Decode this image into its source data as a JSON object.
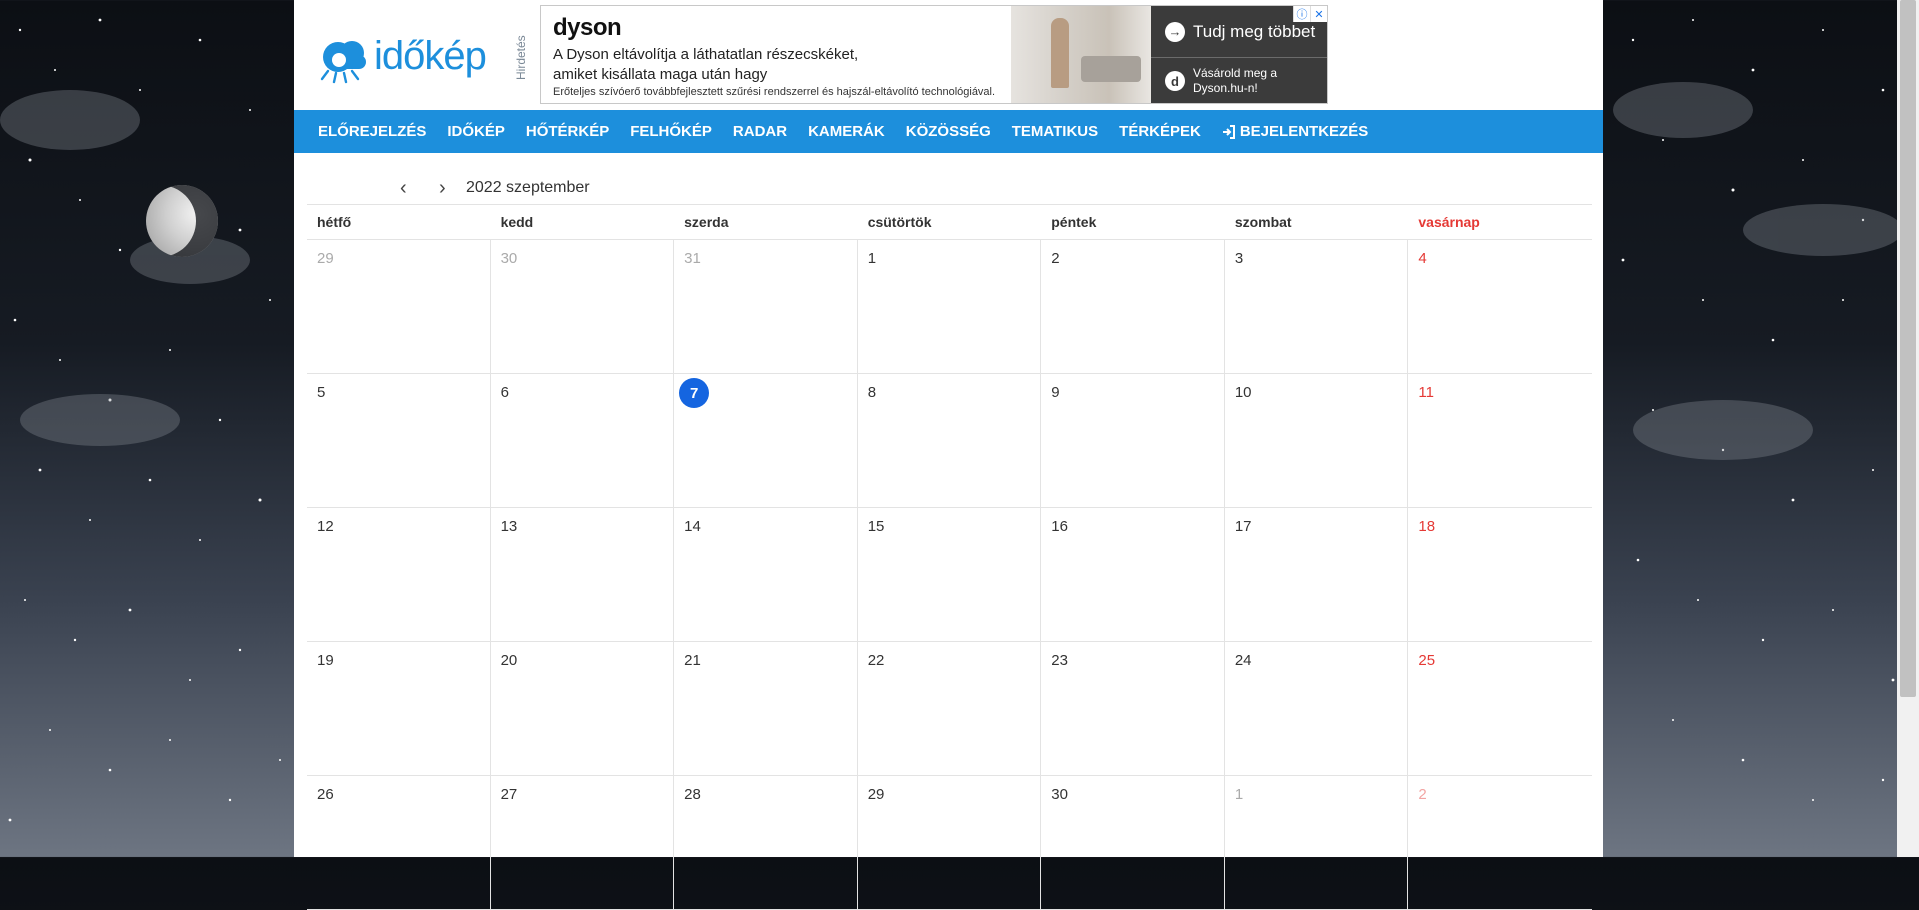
{
  "brand": {
    "logo_text": "időkép"
  },
  "ad": {
    "label": "Hirdetés",
    "brand": "dyson",
    "line1": "A Dyson eltávolítja a láthatatlan részecskéket,",
    "line2": "amiket kisállata maga után hagy",
    "line3": "Erőteljes szívóerő továbbfejlesztett szűrési rendszerrel és hajszál-eltávolító technológiával.",
    "cta_primary": "Tudj meg többet",
    "cta_secondary_line1": "Vásárold meg a",
    "cta_secondary_line2": "Dyson.hu-n!",
    "cta_secondary_icon_letter": "d"
  },
  "nav": {
    "items": [
      {
        "label": "ELŐREJELZÉS"
      },
      {
        "label": "IDŐKÉP"
      },
      {
        "label": "HŐTÉRKÉP"
      },
      {
        "label": "FELHŐKÉP"
      },
      {
        "label": "RADAR"
      },
      {
        "label": "KAMERÁK"
      },
      {
        "label": "KÖZÖSSÉG"
      },
      {
        "label": "TEMATIKUS"
      },
      {
        "label": "TÉRKÉPEK"
      },
      {
        "label": "BEJELENTKEZÉS"
      }
    ]
  },
  "calendar": {
    "title": "2022 szeptember",
    "weekdays": [
      "hétfő",
      "kedd",
      "szerda",
      "csütörtök",
      "péntek",
      "szombat",
      "vasárnap"
    ],
    "weeks": [
      [
        {
          "d": "29",
          "other": true
        },
        {
          "d": "30",
          "other": true
        },
        {
          "d": "31",
          "other": true
        },
        {
          "d": "1"
        },
        {
          "d": "2"
        },
        {
          "d": "3"
        },
        {
          "d": "4"
        }
      ],
      [
        {
          "d": "5"
        },
        {
          "d": "6"
        },
        {
          "d": "7",
          "today": true
        },
        {
          "d": "8"
        },
        {
          "d": "9"
        },
        {
          "d": "10"
        },
        {
          "d": "11"
        }
      ],
      [
        {
          "d": "12"
        },
        {
          "d": "13"
        },
        {
          "d": "14"
        },
        {
          "d": "15"
        },
        {
          "d": "16"
        },
        {
          "d": "17"
        },
        {
          "d": "18"
        }
      ],
      [
        {
          "d": "19"
        },
        {
          "d": "20"
        },
        {
          "d": "21"
        },
        {
          "d": "22"
        },
        {
          "d": "23"
        },
        {
          "d": "24"
        },
        {
          "d": "25"
        }
      ],
      [
        {
          "d": "26"
        },
        {
          "d": "27"
        },
        {
          "d": "28"
        },
        {
          "d": "29"
        },
        {
          "d": "30"
        },
        {
          "d": "1",
          "other": true
        },
        {
          "d": "2",
          "other": true
        }
      ]
    ]
  },
  "colors": {
    "nav_bg": "#1d8fdc",
    "sunday": "#e53935",
    "today_bg": "#1565e0"
  },
  "icons": {
    "prev": "chevron-left-icon",
    "next": "chevron-right-icon",
    "login": "sign-in-icon",
    "ad_info": "info-icon",
    "ad_close": "close-icon",
    "ad_cta": "arrow-right-icon"
  }
}
